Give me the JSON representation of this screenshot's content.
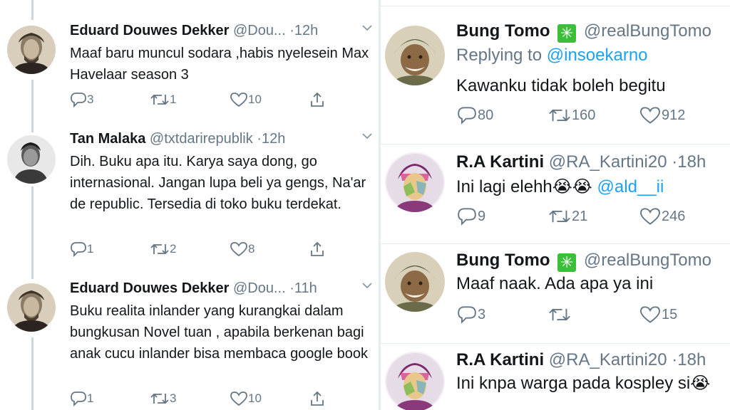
{
  "left": {
    "tweets": [
      {
        "name": "Eduard Douwes Dekker",
        "handle": "@Dou...",
        "time": "12h",
        "text": "Maaf baru muncul sodara ,habis nyelesein Max Havelaar season 3",
        "replies": "3",
        "retweets": "1",
        "likes": "10"
      },
      {
        "name": "Tan Malaka",
        "handle": "@txtdarirepublik",
        "time": "12h",
        "text": "Dih. Buku apa itu. Karya saya dong, go internasional. Jangan lupa beli ya gengs, Na'ar de republic. Tersedia di toko buku terdekat.",
        "replies": "1",
        "retweets": "2",
        "likes": "8"
      },
      {
        "name": "Eduard Douwes Dekker",
        "handle": "@Dou...",
        "time": "11h",
        "text": "Buku realita inlander yang kurangkai dalam bungkusan Novel tuan , apabila berkenan bagi anak cucu inlander bisa membaca google book",
        "replies": "1",
        "retweets": "3",
        "likes": "10"
      }
    ]
  },
  "right": {
    "tweets": [
      {
        "name": "Bung Tomo",
        "verified_mark": "✳",
        "handle": "@realBungTomo",
        "replying_prefix": "Replying to",
        "replying_to": "@insoekarno",
        "text": "Kawanku tidak boleh begitu",
        "replies": "80",
        "retweets": "160",
        "likes": "912"
      },
      {
        "name": "R.A Kartini",
        "handle": "@RA_Kartini20",
        "time": "18h",
        "text": "Ini lagi elehh😭😭",
        "mention": "@ald__ii",
        "replies": "9",
        "retweets": "21",
        "likes": "246"
      },
      {
        "name": "Bung Tomo",
        "verified_mark": "✳",
        "handle": "@realBungTomo",
        "text": "Maaf naak. Ada apa ya ini",
        "replies": "3",
        "retweets": "",
        "likes": "15"
      },
      {
        "name": "R.A Kartini",
        "handle": "@RA_Kartini20",
        "time": "18h",
        "text": "Ini knpa warga pada kospley si😭"
      }
    ]
  },
  "colors": {
    "icon_gray": "#657786",
    "link_blue": "#1da1f2",
    "verified_green": "#3bbf3b",
    "thread_line": "#ccd6dd"
  },
  "icons": [
    "reply-icon",
    "retweet-icon",
    "like-icon",
    "share-icon",
    "chevron-down-icon",
    "verified-icon"
  ]
}
